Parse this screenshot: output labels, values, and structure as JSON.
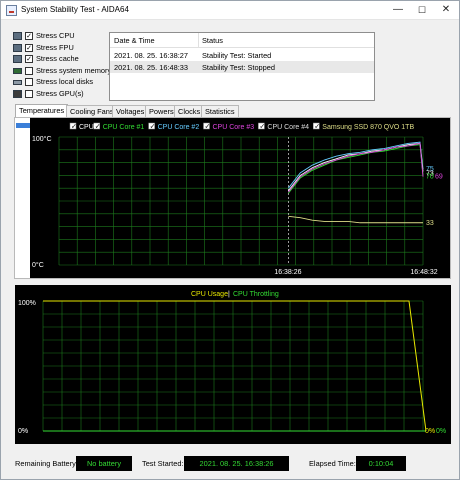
{
  "window": {
    "title": "System Stability Test - AIDA64",
    "minimize": "—",
    "maximize": "☐",
    "close": "✕"
  },
  "options": [
    {
      "label": "Stress CPU",
      "checked": true,
      "icon": "cpu-icon"
    },
    {
      "label": "Stress FPU",
      "checked": true,
      "icon": "fpu-icon"
    },
    {
      "label": "Stress cache",
      "checked": true,
      "icon": "cache-icon"
    },
    {
      "label": "Stress system memory",
      "checked": false,
      "icon": "memory-icon"
    },
    {
      "label": "Stress local disks",
      "checked": false,
      "icon": "disk-icon"
    },
    {
      "label": "Stress GPU(s)",
      "checked": false,
      "icon": "gpu-icon"
    }
  ],
  "log": {
    "columns": [
      "Date & Time",
      "Status"
    ],
    "rows": [
      {
        "datetime": "2021. 08. 25. 16:38:27",
        "status": "Stability Test: Started"
      },
      {
        "datetime": "2021. 08. 25. 16:48:33",
        "status": "Stability Test: Stopped"
      }
    ]
  },
  "tabs": [
    "Temperatures",
    "Cooling Fans",
    "Voltages",
    "Powers",
    "Clocks",
    "Statistics"
  ],
  "active_tab": "Temperatures",
  "chart_data": [
    {
      "type": "line",
      "legend": [
        {
          "name": "CPU",
          "color": "#ffffff",
          "checked": true
        },
        {
          "name": "CPU Core #1",
          "color": "#33dd33",
          "checked": true
        },
        {
          "name": "CPU Core #2",
          "color": "#66ccff",
          "checked": true
        },
        {
          "name": "CPU Core #3",
          "color": "#dd44dd",
          "checked": true
        },
        {
          "name": "CPU Core #4",
          "color": "#dddddd",
          "checked": true
        },
        {
          "name": "Samsung SSD 870 QVO 1TB",
          "color": "#dddd88",
          "checked": true
        }
      ],
      "y_max_label": "100°C",
      "y_min_label": "0°C",
      "ylim": [
        0,
        100
      ],
      "x_labels": [
        "16:38:26",
        "16:48:32"
      ],
      "end_values": [
        "75",
        "73",
        "70",
        "69",
        "33"
      ],
      "series": [
        {
          "name": "CPU Core #2",
          "color": "#66ccff",
          "values": [
            60,
            72,
            78,
            82,
            85,
            87,
            88,
            90,
            91,
            93,
            95,
            96,
            75
          ]
        },
        {
          "name": "CPU",
          "color": "#ffffff",
          "values": [
            58,
            70,
            76,
            80,
            83,
            86,
            87,
            89,
            90,
            92,
            94,
            95,
            73
          ]
        },
        {
          "name": "CPU Core #1",
          "color": "#33dd33",
          "values": [
            56,
            68,
            74,
            78,
            82,
            84,
            86,
            88,
            89,
            91,
            93,
            94,
            70
          ]
        },
        {
          "name": "CPU Core #3",
          "color": "#dd44dd",
          "values": [
            57,
            69,
            75,
            79,
            82,
            85,
            87,
            88,
            90,
            92,
            93,
            95,
            69
          ]
        },
        {
          "name": "Samsung SSD 870 QVO 1TB",
          "color": "#dddd88",
          "values": [
            38,
            37,
            35,
            34,
            34,
            34,
            33,
            33,
            33,
            33,
            33,
            33,
            33
          ]
        }
      ]
    },
    {
      "type": "line",
      "legend": [
        {
          "name": "CPU Usage",
          "color": "#e8e800"
        },
        {
          "name": "CPU Throttling",
          "color": "#33dd33"
        }
      ],
      "legend_separator": "|",
      "y_max_label": "100%",
      "y_min_label": "0%",
      "ylim": [
        0,
        100
      ],
      "end_labels": [
        "0%",
        "0%"
      ],
      "series": [
        {
          "name": "CPU Usage",
          "color": "#e8e800",
          "values": [
            100,
            100,
            100,
            100,
            100,
            100,
            100,
            100,
            100,
            100,
            100,
            100,
            100,
            0
          ]
        },
        {
          "name": "CPU Throttling",
          "color": "#33dd33",
          "values": [
            0,
            0,
            0,
            0,
            0,
            0,
            0,
            0,
            0,
            0,
            0,
            0,
            0,
            0
          ]
        }
      ]
    }
  ],
  "status": {
    "battery_label": "Remaining Battery:",
    "battery_value": "No battery",
    "started_label": "Test Started:",
    "started_value": "2021. 08. 25. 16:38:26",
    "elapsed_label": "Elapsed Time:",
    "elapsed_value": "0:10:04"
  }
}
